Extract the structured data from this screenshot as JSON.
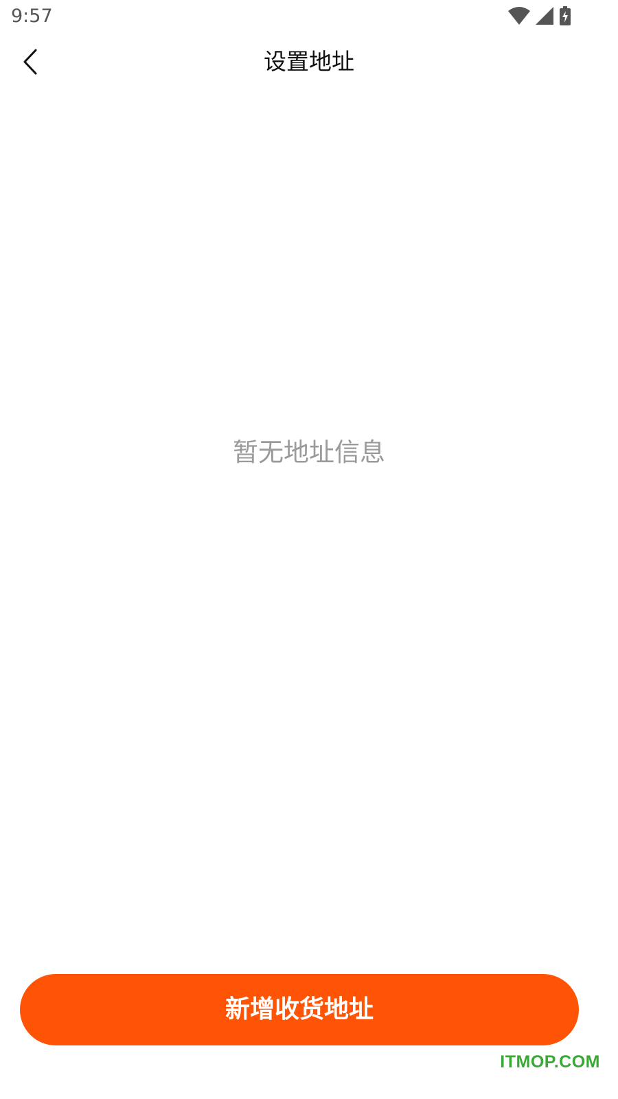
{
  "status_bar": {
    "time": "9:57",
    "icons": [
      "wifi-icon",
      "signal-icon",
      "battery-charging-icon"
    ]
  },
  "header": {
    "back_icon": "chevron-left-icon",
    "title": "设置地址"
  },
  "main": {
    "empty_message": "暂无地址信息"
  },
  "footer": {
    "add_button_label": "新增收货地址"
  },
  "watermark": "ITMOP.COM",
  "colors": {
    "accent": "#ff5405",
    "empty_text": "#9a9a9a",
    "watermark": "#3aa836"
  }
}
